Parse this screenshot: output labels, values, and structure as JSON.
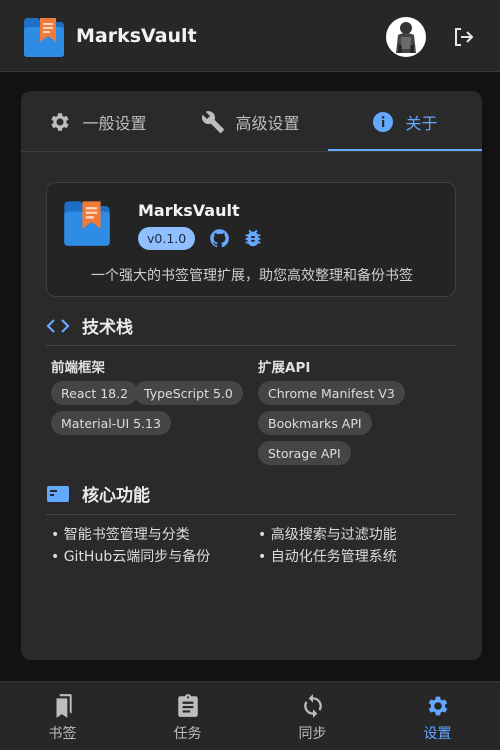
{
  "app": {
    "title": "MarksVault",
    "logo_icon": "bookmark-folder-logo",
    "avatar_icon": "user-avatar",
    "logout_icon": "logout-icon"
  },
  "tabs": [
    {
      "label": "一般设置",
      "icon": "gear-icon"
    },
    {
      "label": "高级设置",
      "icon": "wrench-icon"
    },
    {
      "label": "关于",
      "icon": "info-icon"
    }
  ],
  "active_tab": "关于",
  "about": {
    "name": "MarksVault",
    "version": "v0.1.0",
    "description": "一个强大的书签管理扩展，助您高效整理和备份书签",
    "github_icon": "github-icon",
    "bug_icon": "bug-icon"
  },
  "tech_stack": {
    "heading": "技术栈",
    "frontend": {
      "title": "前端框架",
      "items": [
        "React 18.2",
        "TypeScript 5.0",
        "Material-UI 5.13"
      ]
    },
    "extension": {
      "title": "扩展API",
      "items": [
        "Chrome Manifest V3",
        "Bookmarks API",
        "Storage API"
      ]
    }
  },
  "features": {
    "heading": "核心功能",
    "left": [
      "• 智能书签管理与分类",
      "• GitHub云端同步与备份"
    ],
    "right": [
      "• 高级搜索与过滤功能",
      "• 自动化任务管理系统"
    ]
  },
  "bottom_nav": [
    {
      "label": "书签",
      "icon": "bookmarks-icon"
    },
    {
      "label": "任务",
      "icon": "clipboard-icon"
    },
    {
      "label": "同步",
      "icon": "sync-icon"
    },
    {
      "label": "设置",
      "icon": "gear-icon"
    }
  ],
  "active_nav": "设置",
  "colors": {
    "accent": "#64a8ff",
    "background": "#121212",
    "surface": "#2a2a2a",
    "logo_blue": "#2f8ce4",
    "logo_orange": "#f07a3a"
  }
}
